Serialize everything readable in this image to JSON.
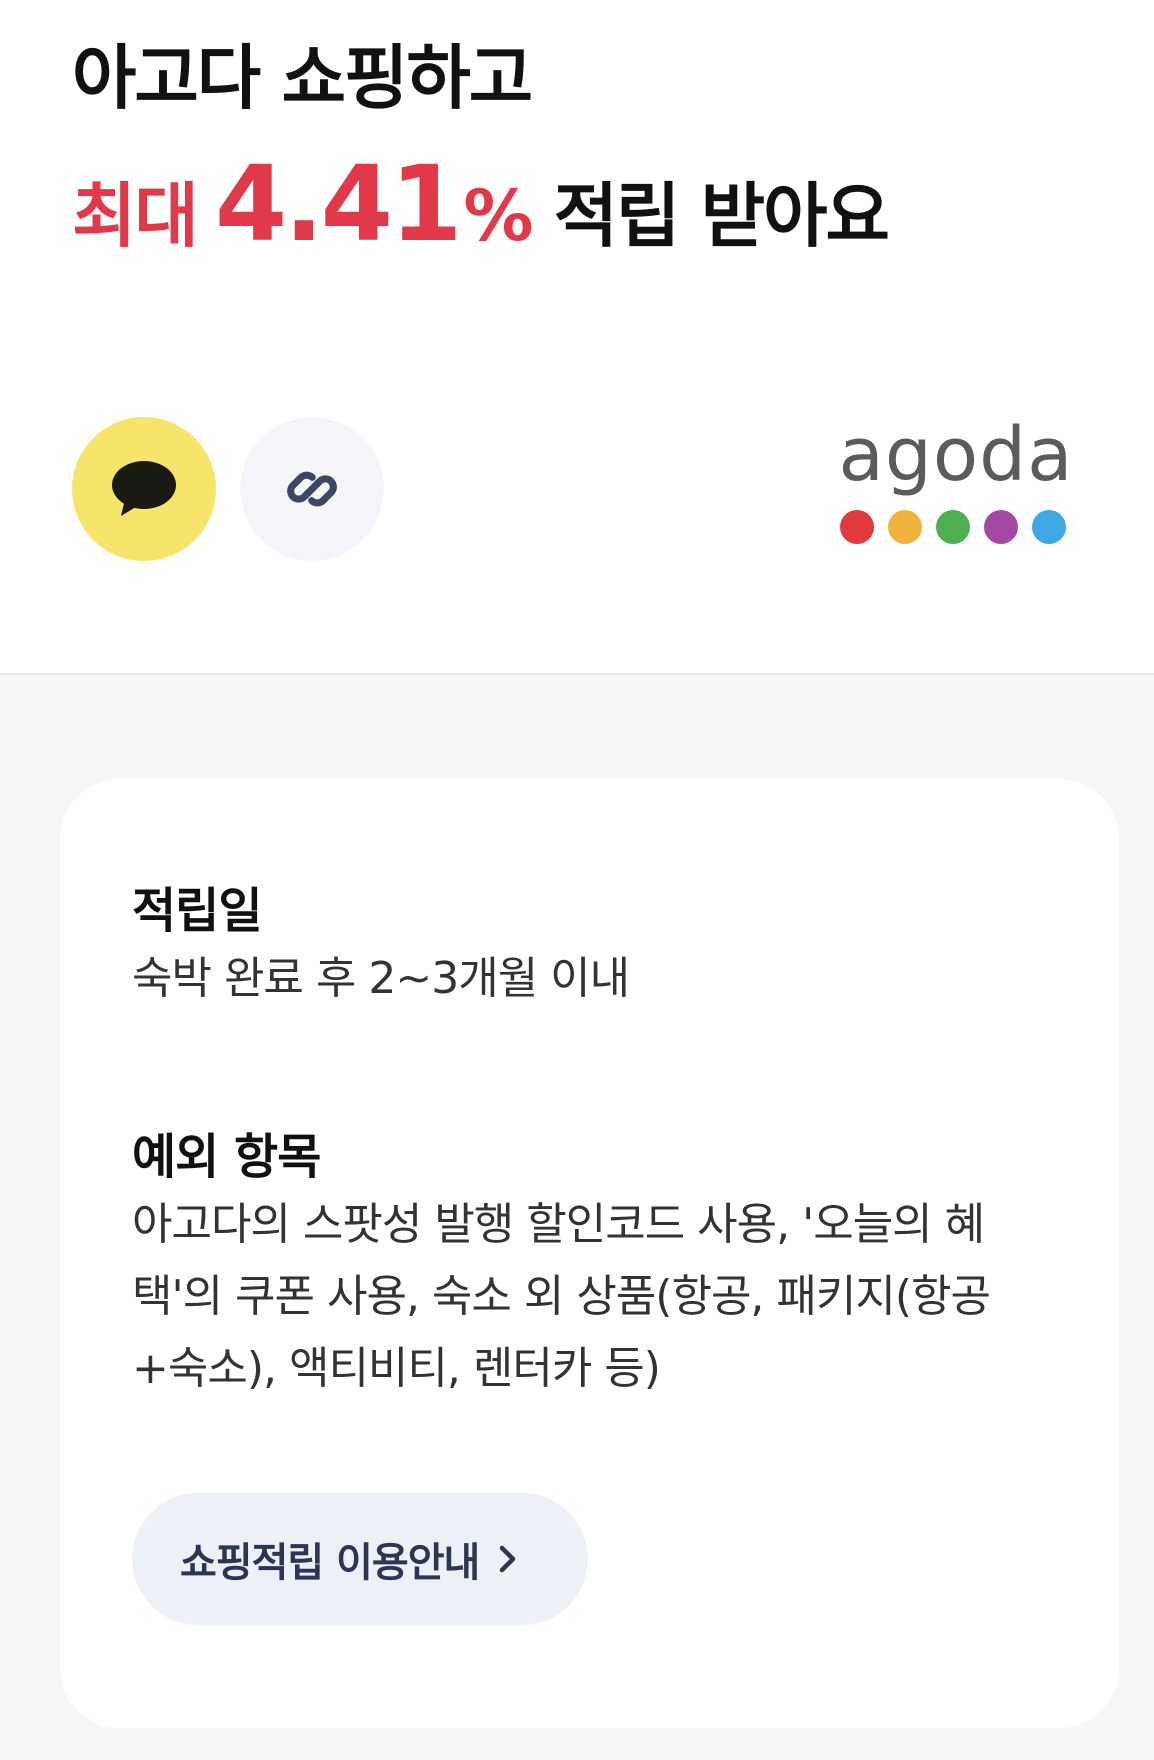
{
  "headline": {
    "line1": "아고다 쇼핑하고",
    "max_label": "최대",
    "rate_value": "4.41",
    "rate_unit": "%",
    "line2_rest": "적립 받아요"
  },
  "share": {
    "kakao_icon": "kakao-speech-bubble-icon",
    "link_icon": "link-chain-icon"
  },
  "brand": {
    "logo_text": "agoda",
    "dot_colors": [
      "#e2393f",
      "#f2b33d",
      "#4caf50",
      "#a349a4",
      "#3ea8e5"
    ]
  },
  "colors": {
    "accent_red": "#e2394a",
    "kakao_yellow": "#f6e56a",
    "button_bg": "#eef0f8",
    "page_bg": "#f6f7f9"
  },
  "info": {
    "accrual_title": "적립일",
    "accrual_body": "숙박 완료 후 2~3개월 이내",
    "exclusion_title": "예외 항목",
    "exclusion_body": "아고다의 스팟성 발행 할인코드 사용, '오늘의 혜택'의 쿠폰 사용, 숙소 외 상품(항공, 패키지(항공+숙소), 액티비티, 렌터카 등)"
  },
  "guide_button": {
    "label": "쇼핑적립 이용안내",
    "icon": "chevron-right-icon"
  }
}
